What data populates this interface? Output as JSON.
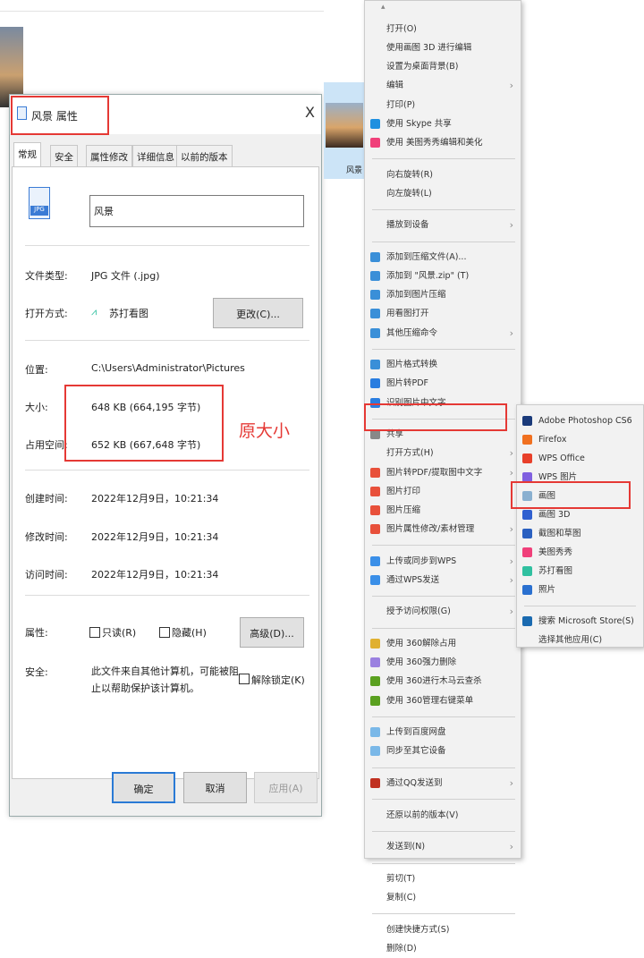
{
  "dialog": {
    "title": "风景 属性",
    "close": "X",
    "tabs": [
      "常规",
      "安全",
      "属性修改",
      "详细信息",
      "以前的版本"
    ],
    "file_name": "风景",
    "file_icon_label": "JPG",
    "type_label": "文件类型:",
    "type_value": "JPG 文件 (.jpg)",
    "open_label": "打开方式:",
    "open_value": "苏打看图",
    "change_button": "更改(C)...",
    "location_label": "位置:",
    "location_value": "C:\\Users\\Administrator\\Pictures",
    "size_label": "大小:",
    "size_value": "648 KB (664,195 字节)",
    "disk_label": "占用空间:",
    "disk_value": "652 KB (667,648 字节)",
    "annotation": "原大小",
    "created_label": "创建时间:",
    "created_value": "2022年12月9日，10:21:34",
    "modified_label": "修改时间:",
    "modified_value": "2022年12月9日，10:21:34",
    "accessed_label": "访问时间:",
    "accessed_value": "2022年12月9日，10:21:34",
    "attr_label": "属性:",
    "readonly": "只读(R)",
    "hidden": "隐藏(H)",
    "advanced_button": "高级(D)...",
    "security_label": "安全:",
    "security_text": "此文件来自其他计算机，可能被阻止以帮助保护该计算机。",
    "unblock": "解除锁定(K)",
    "ok": "确定",
    "cancel": "取消",
    "apply": "应用(A)"
  },
  "explorer": {
    "thumb_label": "风景"
  },
  "menu": {
    "items": [
      {
        "t": "打开(O)"
      },
      {
        "t": "使用画图 3D 进行编辑"
      },
      {
        "t": "设置为桌面背景(B)"
      },
      {
        "t": "编辑",
        "s": 1
      },
      {
        "t": "打印(P)"
      },
      {
        "t": "使用 Skype 共享",
        "c": "#1e90e0"
      },
      {
        "t": "使用 美图秀秀编辑和美化",
        "c": "#f0407a"
      },
      {
        "sep": 1
      },
      {
        "t": "向右旋转(R)"
      },
      {
        "t": "向左旋转(L)"
      },
      {
        "sep": 1
      },
      {
        "t": "播放到设备",
        "s": 1
      },
      {
        "sep": 1
      },
      {
        "t": "添加到压缩文件(A)...",
        "c": "#3a8fd8"
      },
      {
        "t": "添加到 \"风景.zip\" (T)",
        "c": "#3a8fd8"
      },
      {
        "t": "添加到图片压缩",
        "c": "#3a8fd8"
      },
      {
        "t": "用看图打开",
        "c": "#3a8fd8"
      },
      {
        "t": "其他压缩命令",
        "c": "#3a8fd8",
        "s": 1
      },
      {
        "sep": 1
      },
      {
        "t": "图片格式转换",
        "c": "#3a8fd8"
      },
      {
        "t": "图片转PDF",
        "c": "#2a7de0"
      },
      {
        "t": "识别图片中文字",
        "c": "#2a7de0"
      },
      {
        "sep": 1
      },
      {
        "t": "共享",
        "c": "#888"
      },
      {
        "t": "打开方式(H)",
        "s": 1,
        "hl": 1
      },
      {
        "t": "图片转PDF/提取图中文字",
        "c": "#e8503a",
        "s": 1
      },
      {
        "t": "图片打印",
        "c": "#e8503a"
      },
      {
        "t": "图片压缩",
        "c": "#e8503a"
      },
      {
        "t": "图片属性修改/素材管理",
        "c": "#e8503a",
        "s": 1
      },
      {
        "sep": 1
      },
      {
        "t": "上传或同步到WPS",
        "c": "#3a8fe8",
        "s": 1
      },
      {
        "t": "通过WPS发送",
        "c": "#3a8fe8",
        "s": 1
      },
      {
        "sep": 1
      },
      {
        "t": "授予访问权限(G)",
        "s": 1
      },
      {
        "sep": 1
      },
      {
        "t": "使用 360解除占用",
        "c": "#e0b030"
      },
      {
        "t": "使用 360强力删除",
        "c": "#9a80e0"
      },
      {
        "t": "使用 360进行木马云查杀",
        "c": "#5aa020"
      },
      {
        "t": "使用 360管理右键菜单",
        "c": "#5aa020"
      },
      {
        "sep": 1
      },
      {
        "t": "上传到百度网盘",
        "c": "#7ab8e8"
      },
      {
        "t": "同步至其它设备",
        "c": "#7ab8e8"
      },
      {
        "sep": 1
      },
      {
        "t": "通过QQ发送到",
        "c": "#c03020",
        "s": 1
      },
      {
        "sep": 1
      },
      {
        "t": "还原以前的版本(V)"
      },
      {
        "sep": 1
      },
      {
        "t": "发送到(N)",
        "s": 1
      },
      {
        "sep": 1
      },
      {
        "t": "剪切(T)"
      },
      {
        "t": "复制(C)"
      },
      {
        "sep": 1
      },
      {
        "t": "创建快捷方式(S)"
      },
      {
        "t": "删除(D)"
      }
    ]
  },
  "submenu": {
    "items": [
      {
        "t": "Adobe Photoshop CS6",
        "c": "#1a3a7a"
      },
      {
        "t": "Firefox",
        "c": "#f07020"
      },
      {
        "t": "WPS Office",
        "c": "#e8402a"
      },
      {
        "t": "WPS 图片",
        "c": "#8060e0"
      },
      {
        "t": "画图",
        "c": "#8ab0d0",
        "hl": 1
      },
      {
        "t": "画图 3D",
        "c": "#3060d0"
      },
      {
        "t": "截图和草图",
        "c": "#2a60c0"
      },
      {
        "t": "美图秀秀",
        "c": "#f0407a"
      },
      {
        "t": "苏打看图",
        "c": "#30c0a0"
      },
      {
        "t": "照片",
        "c": "#2a70d0"
      },
      {
        "sep": 1
      },
      {
        "t": "搜索 Microsoft Store(S)",
        "c": "#1a6ab0"
      },
      {
        "t": "选择其他应用(C)"
      }
    ]
  },
  "colors": {
    "highlight": "#e53935",
    "annotation": "#e53935"
  }
}
